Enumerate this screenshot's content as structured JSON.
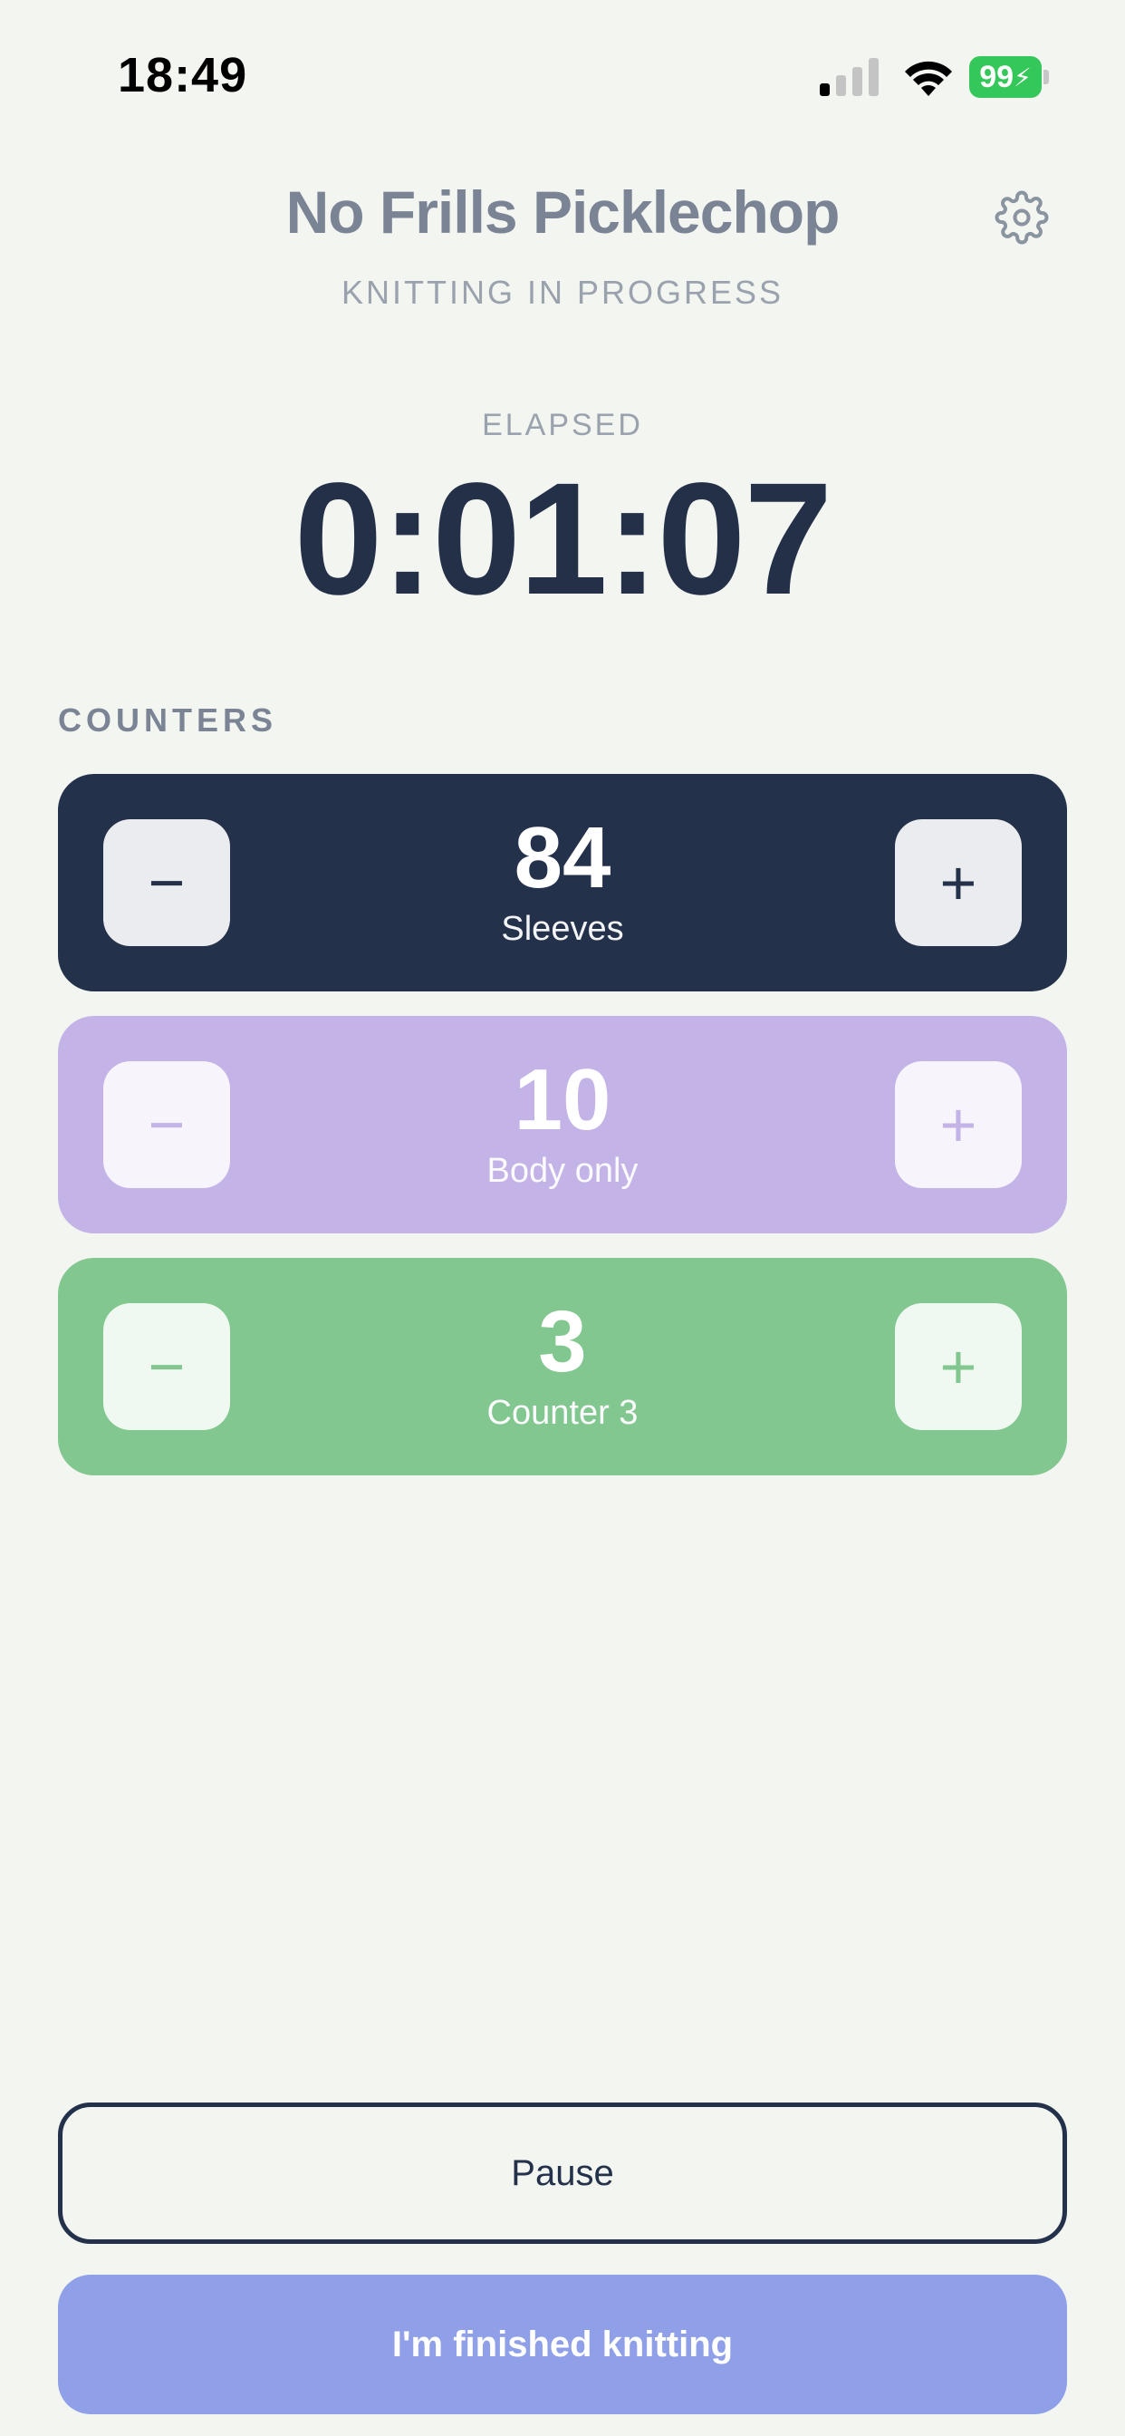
{
  "status_bar": {
    "time": "18:49",
    "battery_level": "99",
    "battery_color": "#34c759"
  },
  "header": {
    "title": "No Frills Picklechop",
    "subtitle": "KNITTING IN PROGRESS",
    "settings_icon": "gear-icon"
  },
  "timer": {
    "label": "ELAPSED",
    "value": "0:01:07"
  },
  "counters": {
    "label": "COUNTERS",
    "items": [
      {
        "value": "84",
        "name": "Sleeves",
        "color": "#24314b",
        "minus": "−",
        "plus": "+"
      },
      {
        "value": "10",
        "name": "Body only",
        "color": "#c4b3e6",
        "minus": "−",
        "plus": "+"
      },
      {
        "value": "3",
        "name": "Counter 3",
        "color": "#82c78f",
        "minus": "−",
        "plus": "+"
      }
    ]
  },
  "actions": {
    "pause_label": "Pause",
    "finish_label": "I'm finished knitting",
    "finish_color": "#8f9fe8"
  }
}
